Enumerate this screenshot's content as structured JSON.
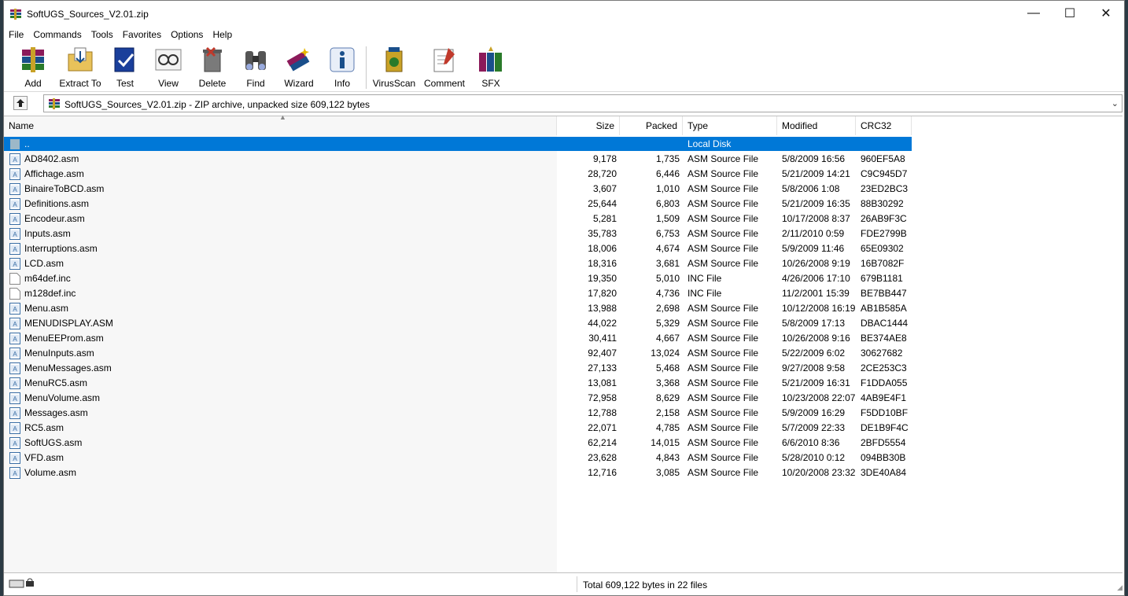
{
  "window": {
    "title": "SoftUGS_Sources_V2.01.zip",
    "controls": {
      "minimize": "—",
      "maximize": "☐",
      "close": "✕"
    }
  },
  "menu": [
    "File",
    "Commands",
    "Tools",
    "Favorites",
    "Options",
    "Help"
  ],
  "toolbar": [
    {
      "label": "Add",
      "icon": "add-archive-icon"
    },
    {
      "label": "Extract To",
      "icon": "extract-folder-icon"
    },
    {
      "label": "Test",
      "icon": "test-book-icon"
    },
    {
      "label": "View",
      "icon": "view-glasses-icon"
    },
    {
      "label": "Delete",
      "icon": "delete-bin-icon"
    },
    {
      "label": "Find",
      "icon": "find-binoculars-icon"
    },
    {
      "label": "Wizard",
      "icon": "wizard-icon"
    },
    {
      "label": "Info",
      "icon": "info-icon"
    },
    {
      "label": "VirusScan",
      "icon": "virus-scan-icon"
    },
    {
      "label": "Comment",
      "icon": "comment-pen-icon"
    },
    {
      "label": "SFX",
      "icon": "sfx-books-icon"
    }
  ],
  "address": {
    "text": "SoftUGS_Sources_V2.01.zip - ZIP archive, unpacked size 609,122 bytes",
    "dropdown": "⌄"
  },
  "columns": {
    "name": "Name",
    "size": "Size",
    "packed": "Packed",
    "type": "Type",
    "modified": "Modified",
    "crc": "CRC32"
  },
  "parent_row": {
    "name": "..",
    "type": "Local Disk"
  },
  "files": [
    {
      "name": "AD8402.asm",
      "size": "9,178",
      "packed": "1,735",
      "type": "ASM Source File",
      "modified": "5/8/2009 16:56",
      "crc": "960EF5A8",
      "kind": "asm"
    },
    {
      "name": "Affichage.asm",
      "size": "28,720",
      "packed": "6,446",
      "type": "ASM Source File",
      "modified": "5/21/2009 14:21",
      "crc": "C9C945D7",
      "kind": "asm"
    },
    {
      "name": "BinaireToBCD.asm",
      "size": "3,607",
      "packed": "1,010",
      "type": "ASM Source File",
      "modified": "5/8/2006 1:08",
      "crc": "23ED2BC3",
      "kind": "asm"
    },
    {
      "name": "Definitions.asm",
      "size": "25,644",
      "packed": "6,803",
      "type": "ASM Source File",
      "modified": "5/21/2009 16:35",
      "crc": "88B30292",
      "kind": "asm"
    },
    {
      "name": "Encodeur.asm",
      "size": "5,281",
      "packed": "1,509",
      "type": "ASM Source File",
      "modified": "10/17/2008 8:37",
      "crc": "26AB9F3C",
      "kind": "asm"
    },
    {
      "name": "Inputs.asm",
      "size": "35,783",
      "packed": "6,753",
      "type": "ASM Source File",
      "modified": "2/11/2010 0:59",
      "crc": "FDE2799B",
      "kind": "asm"
    },
    {
      "name": "Interruptions.asm",
      "size": "18,006",
      "packed": "4,674",
      "type": "ASM Source File",
      "modified": "5/9/2009 11:46",
      "crc": "65E09302",
      "kind": "asm"
    },
    {
      "name": "LCD.asm",
      "size": "18,316",
      "packed": "3,681",
      "type": "ASM Source File",
      "modified": "10/26/2008 9:19",
      "crc": "16B7082F",
      "kind": "asm"
    },
    {
      "name": "m64def.inc",
      "size": "19,350",
      "packed": "5,010",
      "type": "INC File",
      "modified": "4/26/2006 17:10",
      "crc": "679B1181",
      "kind": "inc"
    },
    {
      "name": "m128def.inc",
      "size": "17,820",
      "packed": "4,736",
      "type": "INC File",
      "modified": "11/2/2001 15:39",
      "crc": "BE7BB447",
      "kind": "inc"
    },
    {
      "name": "Menu.asm",
      "size": "13,988",
      "packed": "2,698",
      "type": "ASM Source File",
      "modified": "10/12/2008 16:19",
      "crc": "AB1B585A",
      "kind": "asm"
    },
    {
      "name": "MENUDISPLAY.ASM",
      "size": "44,022",
      "packed": "5,329",
      "type": "ASM Source File",
      "modified": "5/8/2009 17:13",
      "crc": "DBAC1444",
      "kind": "asm"
    },
    {
      "name": "MenuEEProm.asm",
      "size": "30,411",
      "packed": "4,667",
      "type": "ASM Source File",
      "modified": "10/26/2008 9:16",
      "crc": "BE374AE8",
      "kind": "asm"
    },
    {
      "name": "MenuInputs.asm",
      "size": "92,407",
      "packed": "13,024",
      "type": "ASM Source File",
      "modified": "5/22/2009 6:02",
      "crc": "30627682",
      "kind": "asm"
    },
    {
      "name": "MenuMessages.asm",
      "size": "27,133",
      "packed": "5,468",
      "type": "ASM Source File",
      "modified": "9/27/2008 9:58",
      "crc": "2CE253C3",
      "kind": "asm"
    },
    {
      "name": "MenuRC5.asm",
      "size": "13,081",
      "packed": "3,368",
      "type": "ASM Source File",
      "modified": "5/21/2009 16:31",
      "crc": "F1DDA055",
      "kind": "asm"
    },
    {
      "name": "MenuVolume.asm",
      "size": "72,958",
      "packed": "8,629",
      "type": "ASM Source File",
      "modified": "10/23/2008 22:07",
      "crc": "4AB9E4F1",
      "kind": "asm"
    },
    {
      "name": "Messages.asm",
      "size": "12,788",
      "packed": "2,158",
      "type": "ASM Source File",
      "modified": "5/9/2009 16:29",
      "crc": "F5DD10BF",
      "kind": "asm"
    },
    {
      "name": "RC5.asm",
      "size": "22,071",
      "packed": "4,785",
      "type": "ASM Source File",
      "modified": "5/7/2009 22:33",
      "crc": "DE1B9F4C",
      "kind": "asm"
    },
    {
      "name": "SoftUGS.asm",
      "size": "62,214",
      "packed": "14,015",
      "type": "ASM Source File",
      "modified": "6/6/2010 8:36",
      "crc": "2BFD5554",
      "kind": "asm"
    },
    {
      "name": "VFD.asm",
      "size": "23,628",
      "packed": "4,843",
      "type": "ASM Source File",
      "modified": "5/28/2010 0:12",
      "crc": "094BB30B",
      "kind": "asm"
    },
    {
      "name": "Volume.asm",
      "size": "12,716",
      "packed": "3,085",
      "type": "ASM Source File",
      "modified": "10/20/2008 23:32",
      "crc": "3DE40A84",
      "kind": "asm"
    }
  ],
  "status": {
    "text": "Total 609,122 bytes in 22 files"
  },
  "colors": {
    "selection": "#0078d7"
  }
}
